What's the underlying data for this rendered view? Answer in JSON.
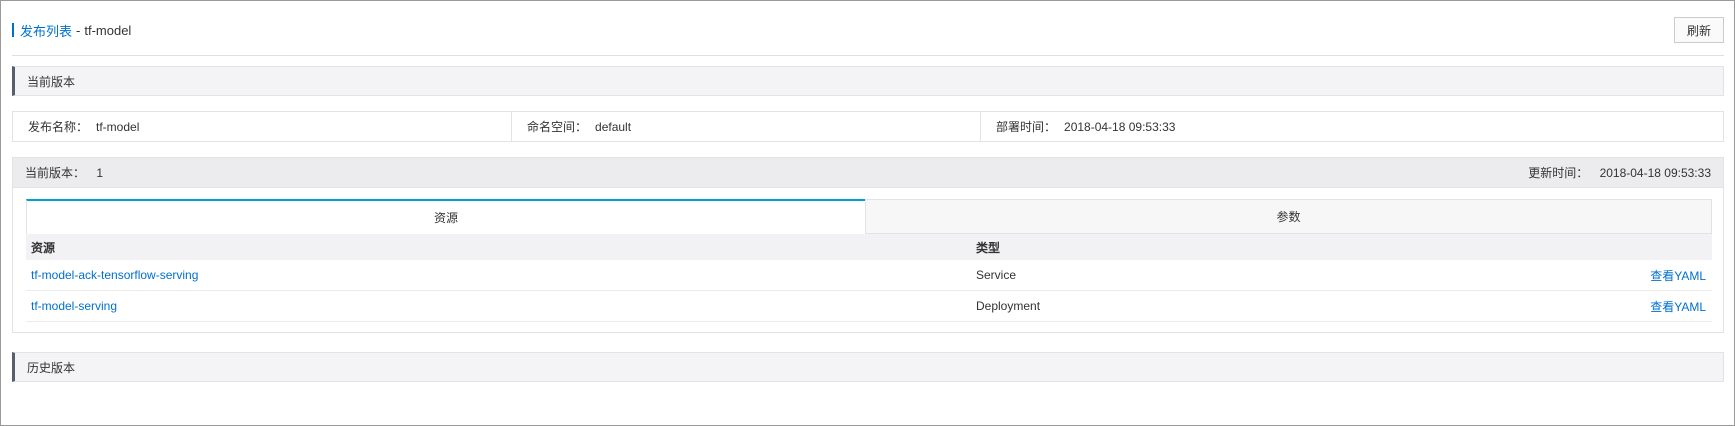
{
  "breadcrumb": {
    "parent": "发布列表",
    "separator": "-",
    "current": "tf-model"
  },
  "toolbar": {
    "refresh_label": "刷新"
  },
  "sections": {
    "current": "当前版本",
    "history": "历史版本"
  },
  "info": {
    "release_label": "发布名称：",
    "release_value": "tf-model",
    "namespace_label": "命名空间：",
    "namespace_value": "default",
    "deploy_time_label": "部署时间：",
    "deploy_time_value": "2018-04-18 09:53:33"
  },
  "version": {
    "current_label": "当前版本：",
    "current_value": "1",
    "updated_label": "更新时间：",
    "updated_value": "2018-04-18 09:53:33"
  },
  "tabs": [
    {
      "label": "资源",
      "active": true
    },
    {
      "label": "参数",
      "active": false
    }
  ],
  "table": {
    "headers": {
      "resource": "资源",
      "type": "类型"
    },
    "rows": [
      {
        "resource": "tf-model-ack-tensorflow-serving",
        "type": "Service",
        "action": "查看YAML"
      },
      {
        "resource": "tf-model-serving",
        "type": "Deployment",
        "action": "查看YAML"
      }
    ]
  },
  "colors": {
    "accent": "#0070cc",
    "tab_active_border": "#00a2ca",
    "section_marker": "#555f6d"
  }
}
